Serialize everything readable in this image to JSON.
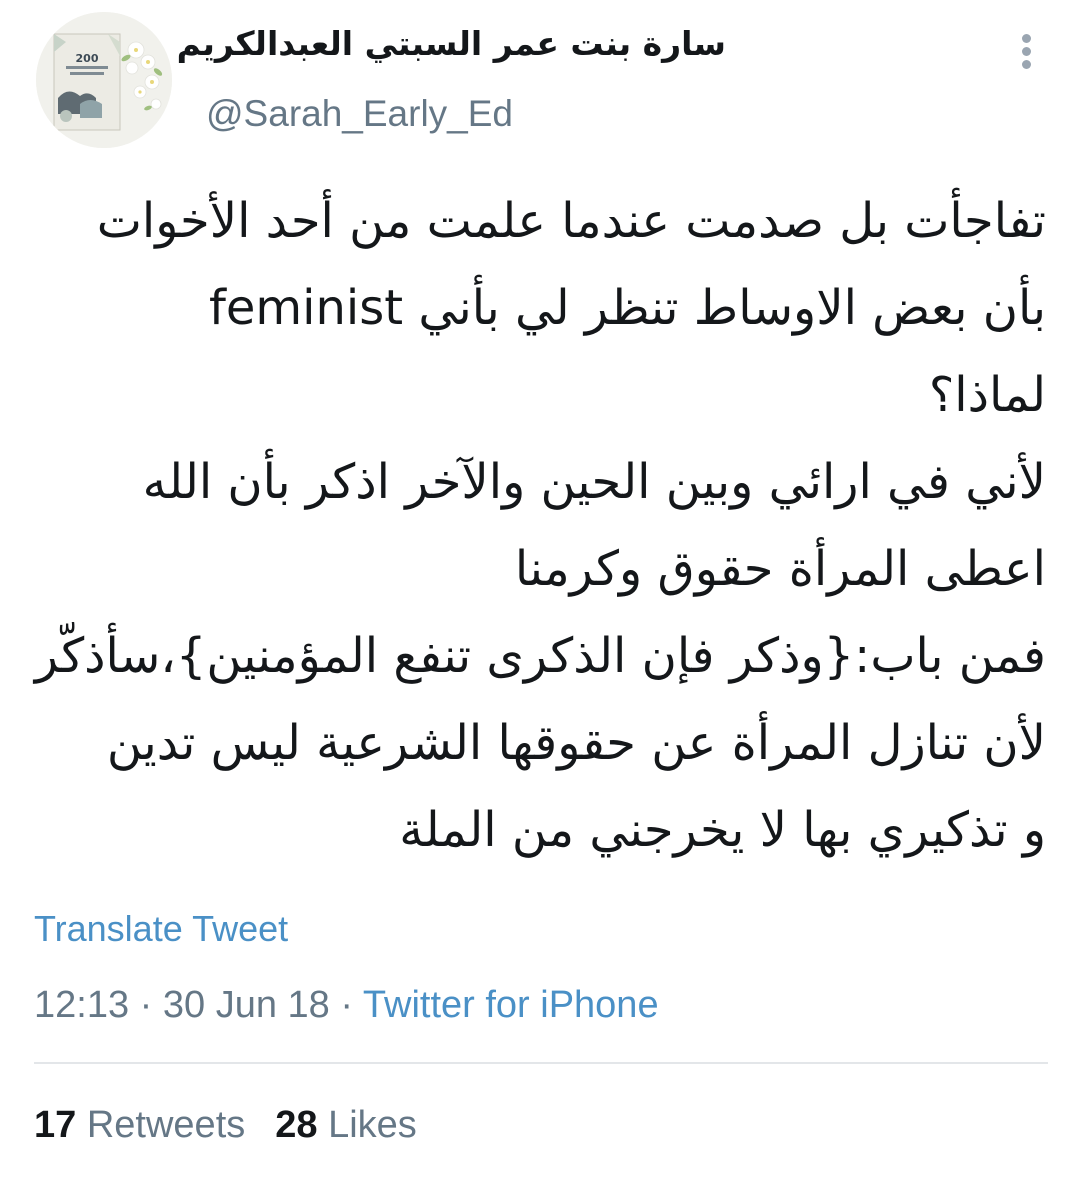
{
  "author": {
    "display_name": "سارة بنت عمر السبتي العبدالكريم",
    "handle": "@Sarah_Early_Ed",
    "avatar_book_number": "200"
  },
  "tweet": {
    "lines": [
      "تفاجأت بل صدمت عندما علمت من أحد الأخوات",
      "بأن بعض الاوساط  تنظر لي بأني feminist",
      "لماذا؟",
      "لأني في ارائي وبين الحين والآخر اذكر بأن الله",
      "اعطى المرأة حقوق وكرمنا",
      "فمن باب:{وذكر فإن الذكرى تنفع المؤمنين}،سأذكّر",
      "لأن تنازل المرأة عن حقوقها الشرعية ليس تدين",
      "و تذكيري بها لا يخرجني من الملة"
    ],
    "translate_label": "Translate Tweet",
    "time": "12:13",
    "date": "30 Jun 18",
    "separator": "·",
    "source": "Twitter for iPhone"
  },
  "stats": {
    "retweets_count": "17",
    "retweets_label": "Retweets",
    "likes_count": "28",
    "likes_label": "Likes"
  },
  "colors": {
    "link": "#4a90c6",
    "secondary_text": "#657786",
    "primary_text": "#14171a",
    "divider": "#e3e6e9"
  },
  "icons": {
    "more": "vertical-ellipsis-icon"
  }
}
